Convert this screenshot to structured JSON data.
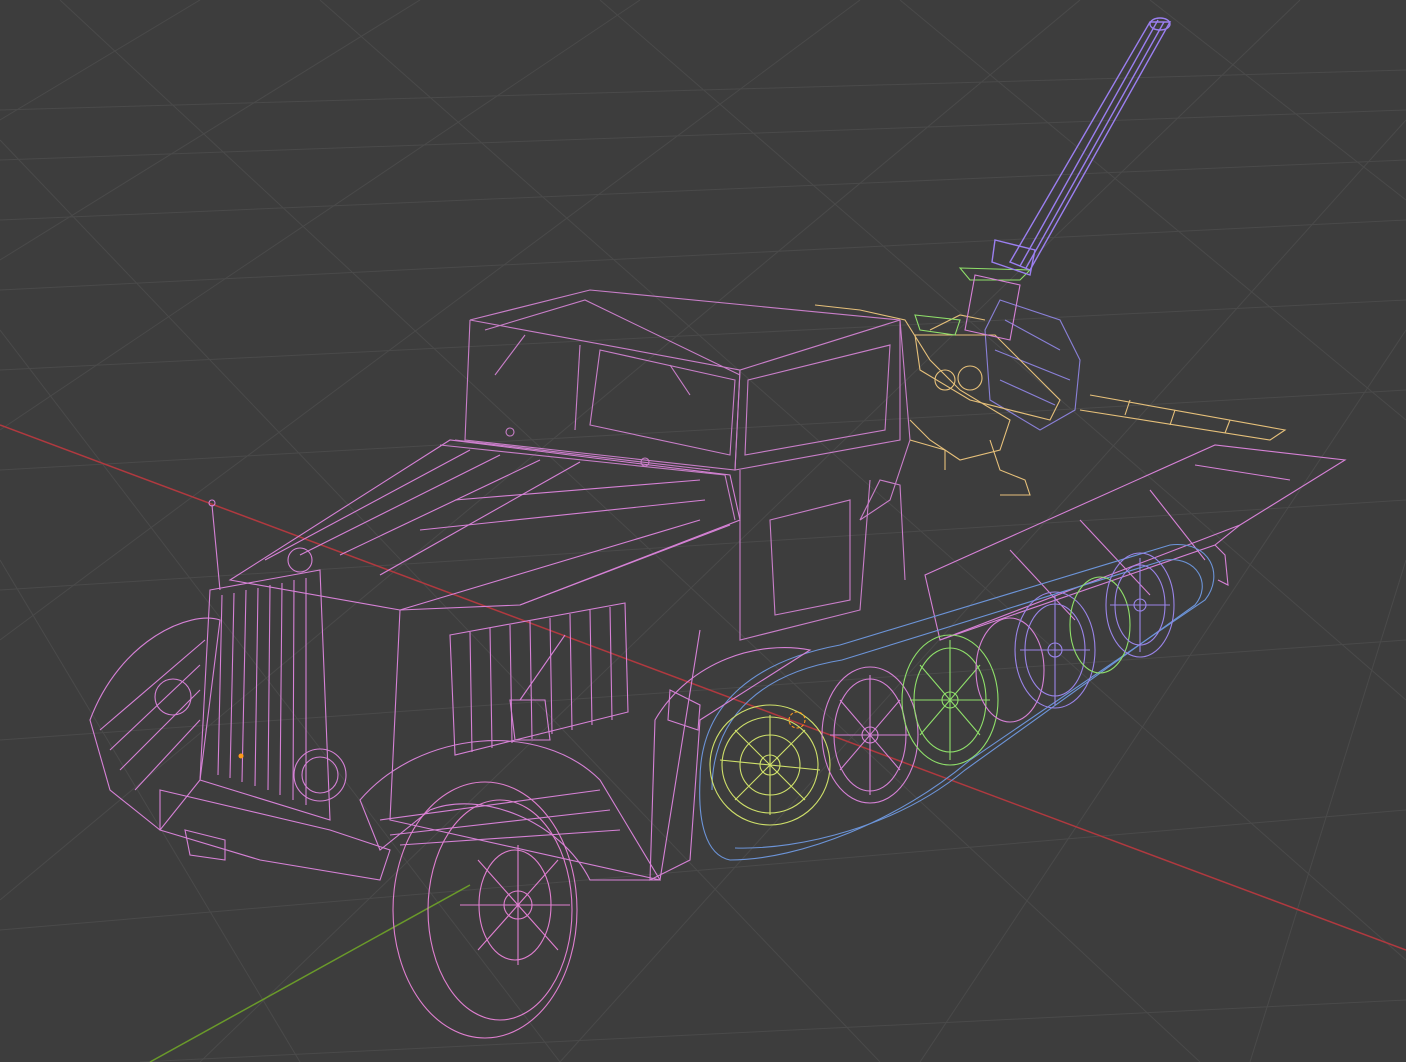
{
  "viewport": {
    "background": "#3d3d3d",
    "grid_color": "#4a4a4a",
    "x_axis_color": "#b0393f",
    "y_axis_color": "#6a9a2a"
  },
  "model": {
    "body_color": "#d681d6",
    "cab_color": "#c97ec9",
    "gun_barrel_color": "#9b7ff0",
    "gun_mount_color": "#e6c07a",
    "green_parts_color": "#8fe06a",
    "purple_wheel_color": "#9a84e8",
    "track_color": "#6c94d8",
    "gun_shield_color": "#8a80d8",
    "selected_dot_color": "#ff9a1a"
  }
}
